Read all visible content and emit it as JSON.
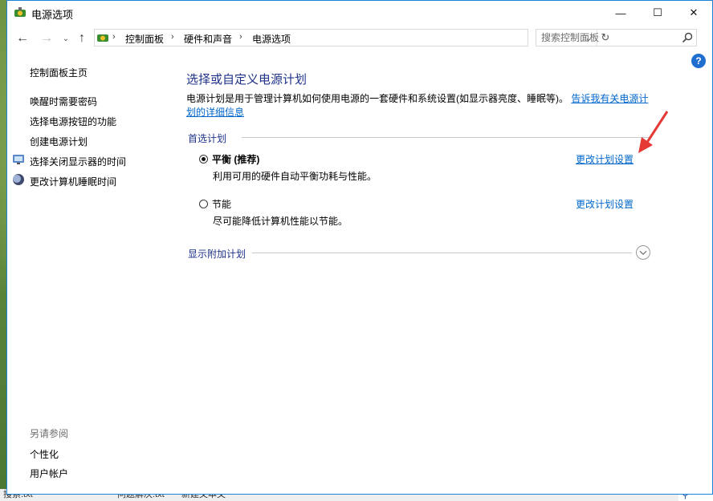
{
  "window": {
    "title": "电源选项"
  },
  "titlebar": {
    "minimize": "—",
    "maximize": "☐",
    "close": "✕"
  },
  "address": {
    "crumbs": [
      "控制面板",
      "硬件和声音",
      "电源选项"
    ],
    "separator": "›"
  },
  "search": {
    "placeholder": "搜索控制面板"
  },
  "help": "?",
  "sidebar": {
    "home": "控制面板主页",
    "items": [
      {
        "label": "唤醒时需要密码"
      },
      {
        "label": "选择电源按钮的功能"
      },
      {
        "label": "创建电源计划"
      },
      {
        "label": "选择关闭显示器的时间"
      },
      {
        "label": "更改计算机睡眠时间"
      }
    ],
    "see_also_title": "另请参阅",
    "see_also": [
      "个性化",
      "用户帐户"
    ]
  },
  "main": {
    "title": "选择或自定义电源计划",
    "desc_text": "电源计划是用于管理计算机如何使用电源的一套硬件和系统设置(如显示器亮度、睡眠等)。",
    "desc_link": "告诉我有关电源计划的详细信息",
    "preferred_header": "首选计划",
    "plans": [
      {
        "name": "平衡 (推荐)",
        "desc": "利用可用的硬件自动平衡功耗与性能。",
        "link": "更改计划设置",
        "selected": true
      },
      {
        "name": "节能",
        "desc": "尽可能降低计算机性能以节能。",
        "link": "更改计划设置",
        "selected": false
      }
    ],
    "additional_header": "显示附加计划"
  },
  "desktop": {
    "strip": [
      "搜索.txt",
      "问题解决.txt",
      "新建文本文"
    ],
    "search_icon": "search-icon"
  },
  "colors": {
    "accent": "#1e3287",
    "link": "#0066cc",
    "border": "#1883d7",
    "arrow": "#e53935"
  }
}
